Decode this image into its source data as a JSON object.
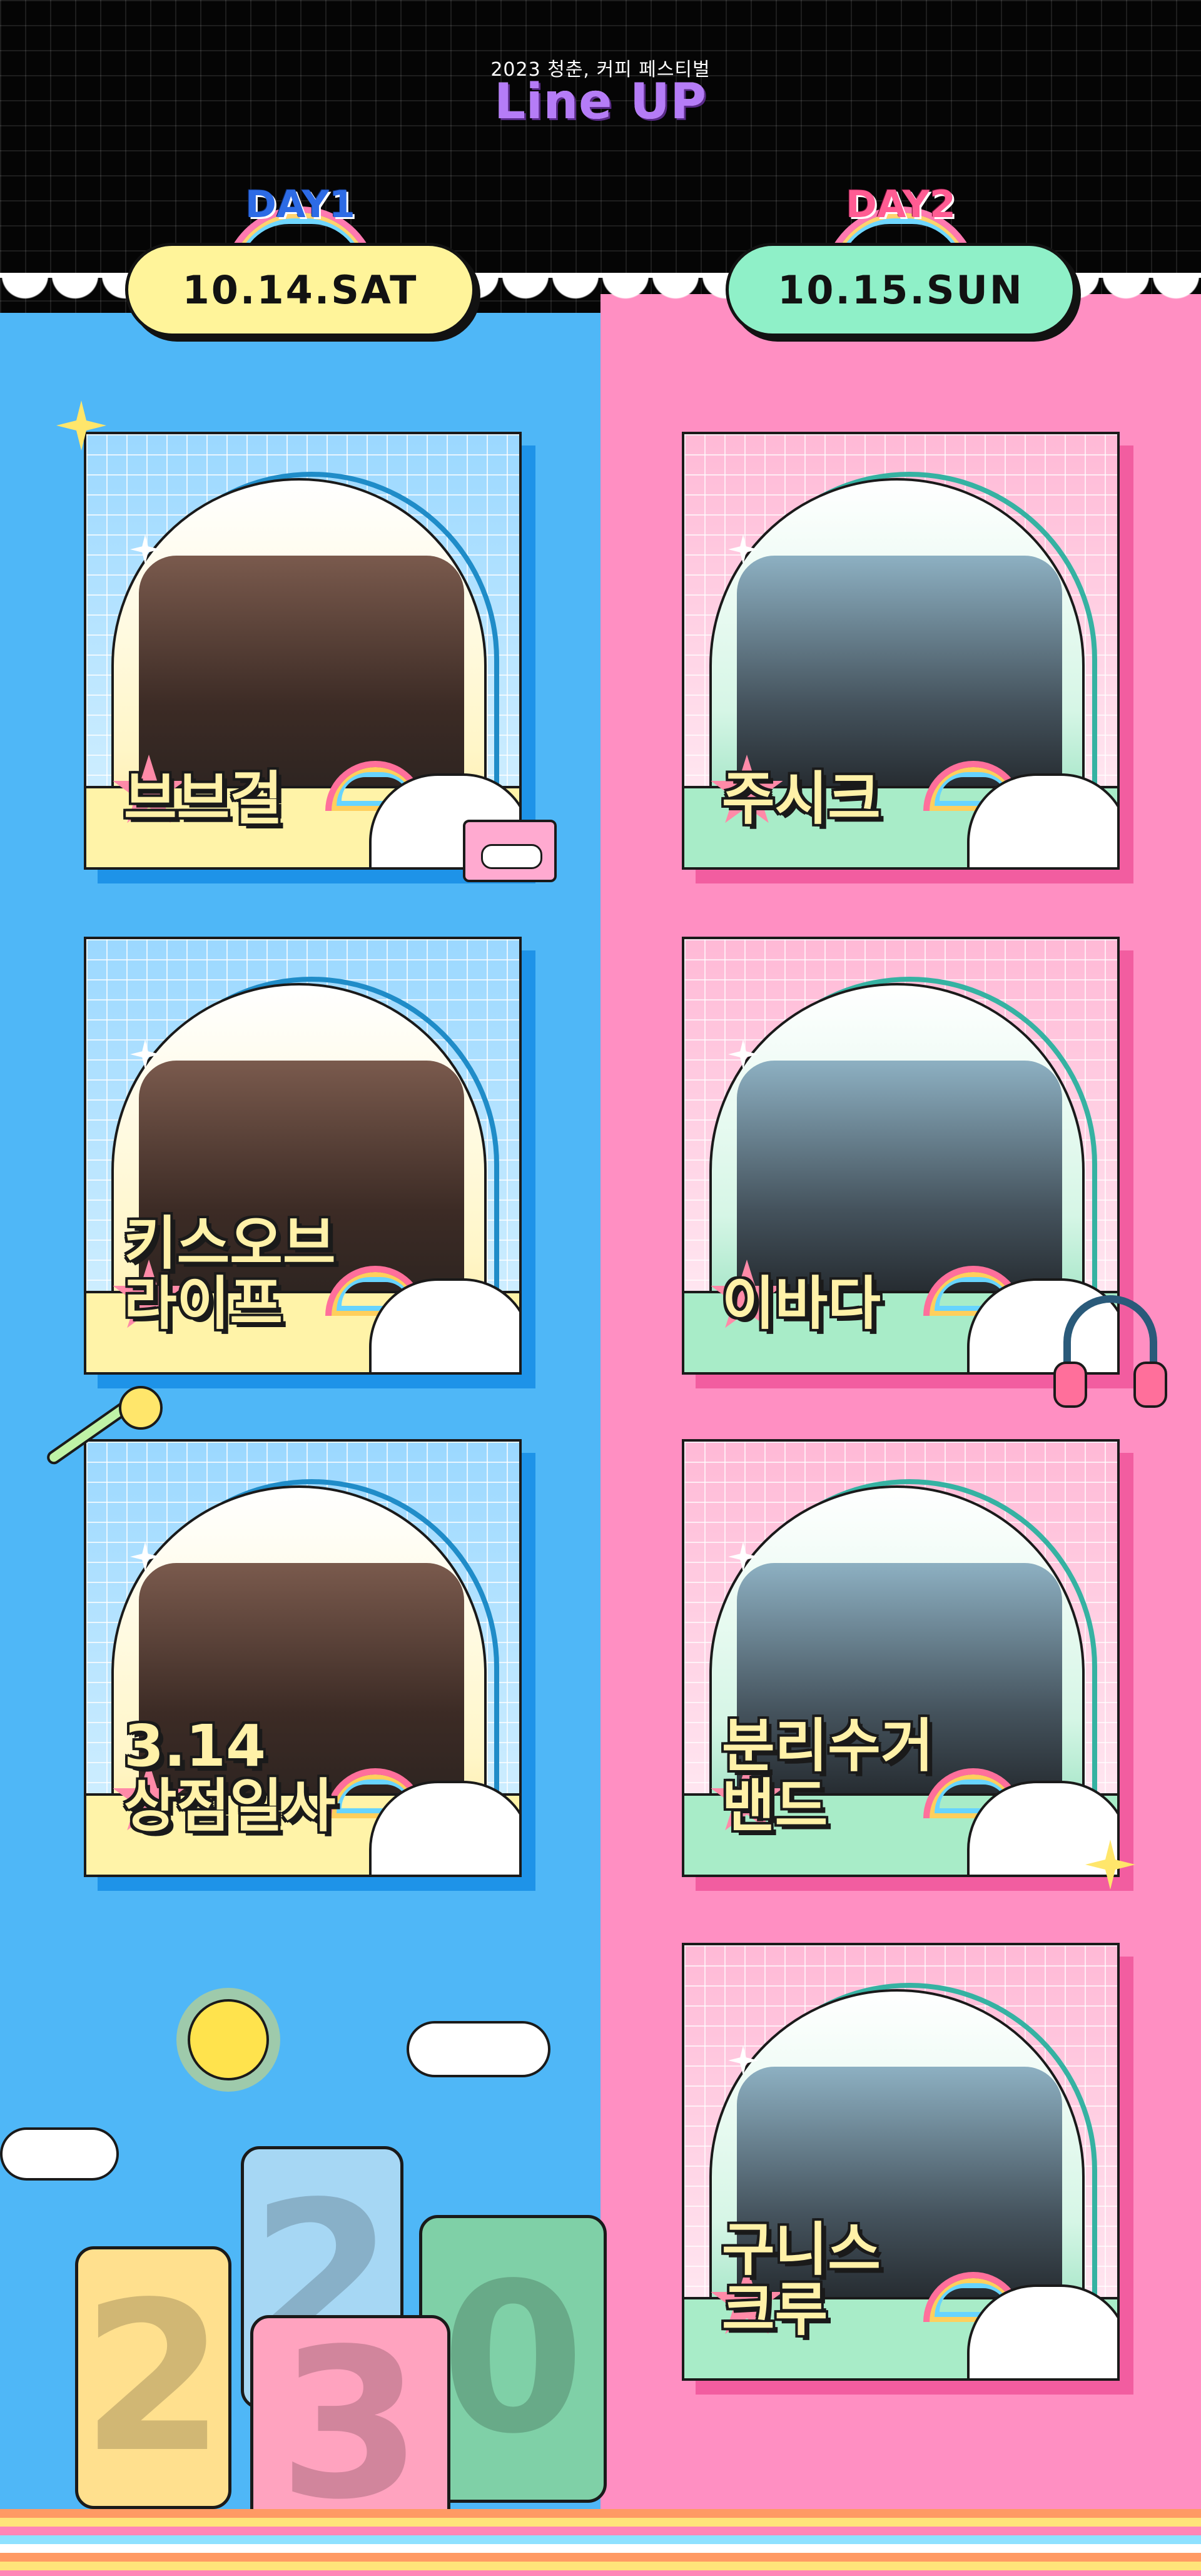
{
  "header": {
    "subtitle": "2023 청춘, 커피 페스티벌",
    "title": "Line UP"
  },
  "days": [
    {
      "label": "DAY1",
      "date": "10.14.SAT",
      "accent": "#2d6be5",
      "cloud_color": "#fff49a"
    },
    {
      "label": "DAY2",
      "date": "10.15.SUN",
      "accent": "#ff5c93",
      "cloud_color": "#8ff0c8"
    }
  ],
  "lineup": {
    "day1": [
      {
        "name": "브브걸"
      },
      {
        "name": "키스오브\n라이프"
      },
      {
        "name": "3.14\n상점일사"
      }
    ],
    "day2": [
      {
        "name": "주시크"
      },
      {
        "name": "이바다"
      },
      {
        "name": "분리수거\n밴드"
      },
      {
        "name": "구니스\n크루"
      }
    ]
  },
  "decorations": {
    "icons": [
      "cassette-icon",
      "microphone-icon",
      "headphones-icon",
      "sun-icon",
      "cloud-icon",
      "sparkle-icon",
      "rainbow-icon"
    ],
    "year_blocks": [
      "2",
      "2",
      "0",
      "3"
    ]
  },
  "colors": {
    "day1_background": "#4fb7f7",
    "day2_background": "#ff8fc2",
    "header_background": "#050505",
    "title_purple": "#b57cf7"
  }
}
